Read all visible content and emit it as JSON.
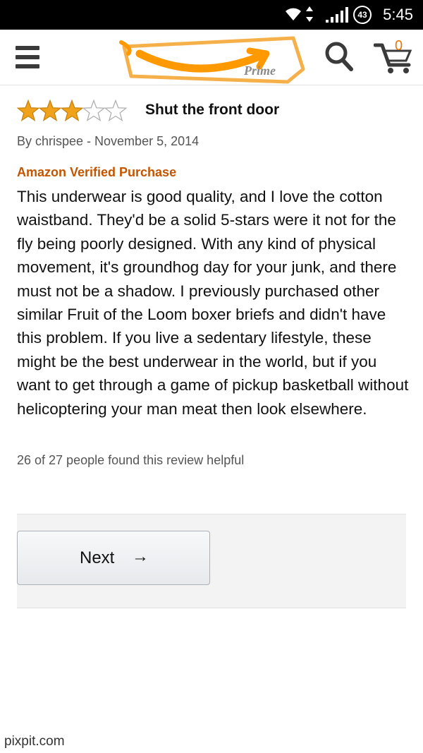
{
  "status_bar": {
    "time": "5:45",
    "battery_level": "43",
    "icons": [
      "wifi-icon",
      "data-transfer-icon",
      "signal-icon",
      "battery-icon"
    ]
  },
  "header": {
    "logo_text": "Prime",
    "cart_count": "0",
    "icons": [
      "menu-icon",
      "amazon-smile-logo",
      "search-icon",
      "cart-icon"
    ]
  },
  "review": {
    "rating": 3,
    "rating_max": 5,
    "title": "Shut the front door",
    "byline": "By chrispee - November 5, 2014",
    "verified": "Amazon Verified Purchase",
    "body": "This underwear is good quality, and I love the cotton waistband. They'd be a solid 5-stars were it not for the fly being poorly designed. With any kind of physical movement, it's groundhog day for your junk, and there must not be a shadow. I previously purchased other similar Fruit of the Loom boxer briefs and didn't have this problem. If you live a sedentary lifestyle, these might be the best underwear in the world, but if you want to get through a game of pickup basketball without helicoptering your man meat then look elsewhere.",
    "helpful": "26 of 27 people found this review helpful"
  },
  "pager": {
    "next_label": "Next",
    "next_arrow": "→"
  },
  "watermark": "pixpit.com",
  "colors": {
    "star": "#f0a21b",
    "brand_orange": "#ff9900",
    "verified": "#c45500"
  }
}
